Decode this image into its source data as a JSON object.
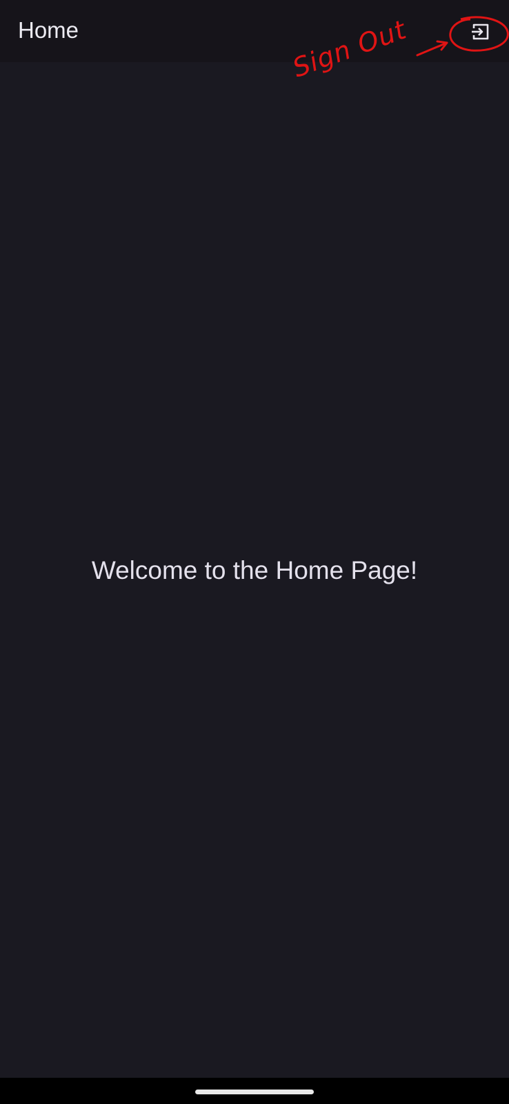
{
  "app_bar": {
    "title": "Home",
    "signout_icon": "exit-to-app-icon"
  },
  "annotation": {
    "label": "Sign Out",
    "color": "#e01414"
  },
  "main": {
    "welcome_text": "Welcome to the Home Page!"
  },
  "colors": {
    "background": "#1a1921",
    "app_bar": "#16141a",
    "text": "#e4e1ec"
  }
}
